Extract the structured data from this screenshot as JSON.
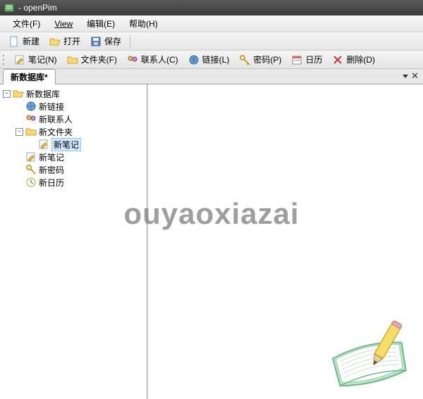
{
  "window": {
    "title": " - openPim"
  },
  "menu": {
    "file": "文件(F)",
    "view": "View",
    "edit": "编辑(E)",
    "help": "帮助(H)"
  },
  "toolbar1": {
    "new": "新建",
    "open": "打开",
    "save": "保存"
  },
  "toolbar2": {
    "note": "笔记(N)",
    "folder": "文件夹(F)",
    "contact": "联系人(C)",
    "link": "链接(L)",
    "password": "密码(P)",
    "calendar": "日历",
    "delete": "删除(D)"
  },
  "tab": {
    "label": "新数据库*"
  },
  "tree": {
    "root": "新数据库",
    "items": [
      {
        "label": "新链接"
      },
      {
        "label": "新联系人"
      },
      {
        "label": "新文件夹",
        "children": [
          {
            "label": "新笔记"
          }
        ]
      },
      {
        "label": "新笔记"
      },
      {
        "label": "新密码"
      },
      {
        "label": "新日历"
      }
    ]
  },
  "watermark": "ouyaoxiazai"
}
